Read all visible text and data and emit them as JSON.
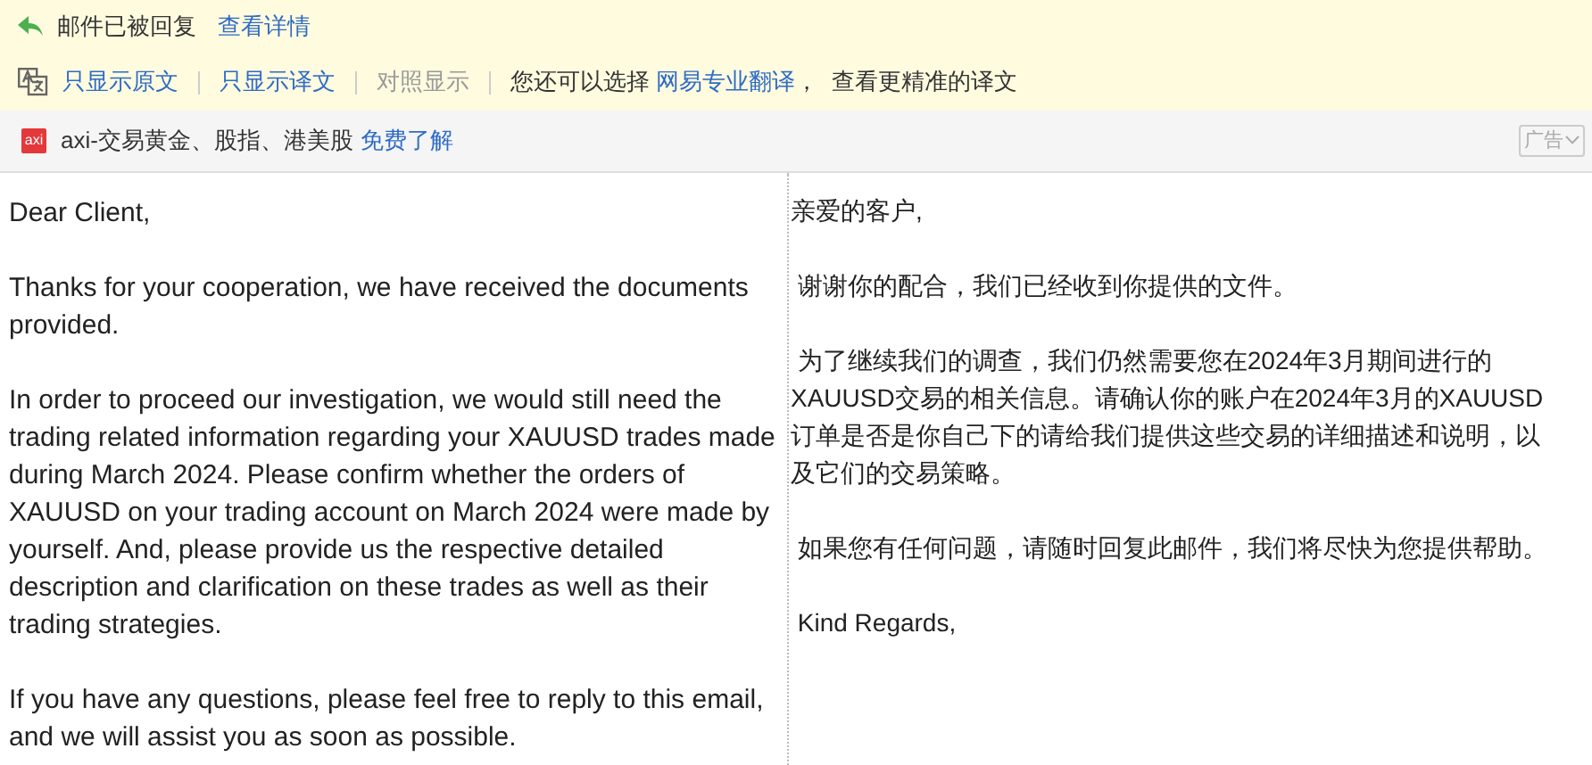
{
  "reply_notice": {
    "text": "邮件已被回复",
    "link": "查看详情"
  },
  "translate_bar": {
    "modes": [
      {
        "label": "只显示原文",
        "disabled": false
      },
      {
        "label": "只显示译文",
        "disabled": false
      },
      {
        "label": "对照显示",
        "disabled": true
      }
    ],
    "hint": "您还可以选择",
    "hint_link": "网易专业翻译",
    "hint_after": "，  查看更精准的译文"
  },
  "ad": {
    "logo": "axi",
    "text": "axi-交易黄金、股指、港美股",
    "link": "免费了解",
    "tag": "广告"
  },
  "original": [
    "Dear Client,",
    "Thanks for your cooperation, we have received the documents provided.",
    "In order to proceed our investigation, we would still need the trading related information regarding your XAUUSD trades made during March 2024. Please confirm whether the orders of XAUUSD on your trading account on March 2024 were made by yourself. And, please provide us the respective detailed description and clarification on these trades as well as their trading strategies.",
    "If you have any questions, please feel free to reply to this email, and we will assist you as soon as possible."
  ],
  "translation": [
    "亲爱的客户,",
    " 谢谢你的配合，我们已经收到你提供的文件。",
    " 为了继续我们的调查，我们仍然需要您在2024年3月期间进行的XAUUSD交易的相关信息。请确认你的账户在2024年3月的XAUUSD订单是否是你自己下的请给我们提供这些交易的详细描述和说明，以及它们的交易策略。",
    " 如果您有任何问题，请随时回复此邮件，我们将尽快为您提供帮助。",
    " Kind Regards,"
  ]
}
